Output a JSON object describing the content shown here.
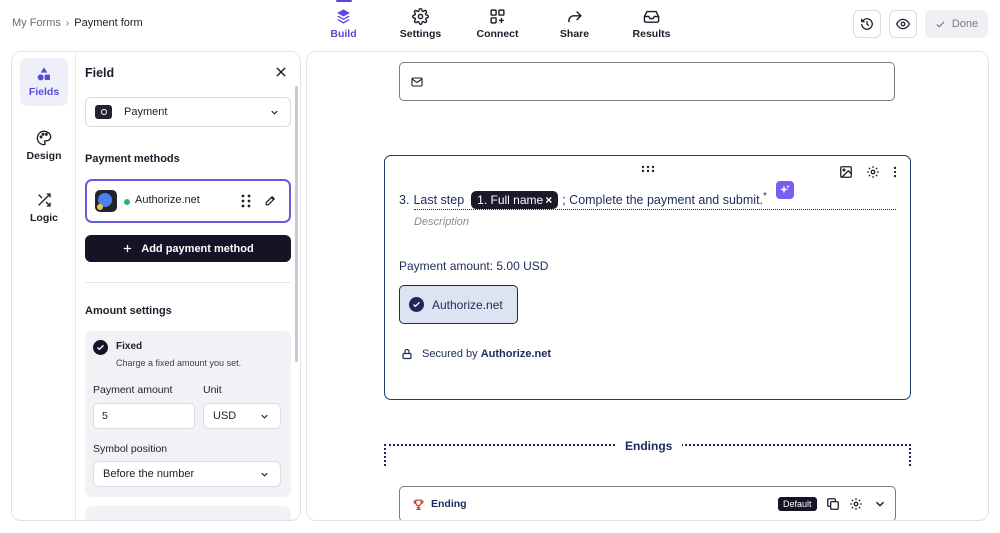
{
  "breadcrumb": {
    "root": "My Forms",
    "separator": "›",
    "current": "Payment form"
  },
  "nav": [
    {
      "label": "Build",
      "icon": "layers-icon",
      "active": true
    },
    {
      "label": "Settings",
      "icon": "gear-icon",
      "active": false
    },
    {
      "label": "Connect",
      "icon": "connect-icon",
      "active": false
    },
    {
      "label": "Share",
      "icon": "share-icon",
      "active": false
    },
    {
      "label": "Results",
      "icon": "inbox-icon",
      "active": false
    }
  ],
  "toolbar": {
    "history_icon": "history-icon",
    "preview_icon": "eye-icon",
    "done_label": "Done"
  },
  "rail": [
    {
      "label": "Fields",
      "icon": "shapes-icon",
      "active": true
    },
    {
      "label": "Design",
      "icon": "palette-icon",
      "active": false
    },
    {
      "label": "Logic",
      "icon": "shuffle-icon",
      "active": false
    }
  ],
  "panel": {
    "title": "Field",
    "field_type": "Payment",
    "methods_label": "Payment methods",
    "method_name": "Authorize.net",
    "add_method_label": "Add payment method",
    "amount_settings_label": "Amount settings",
    "fixed_title": "Fixed",
    "fixed_desc": "Charge a fixed amount you set.",
    "payment_amount_label": "Payment amount",
    "payment_amount_value": "5",
    "unit_label": "Unit",
    "unit_value": "USD",
    "symbol_position_label": "Symbol position",
    "symbol_position_value": "Before the number"
  },
  "canvas": {
    "question_number": "3.",
    "question_prefix": "Last step",
    "chip_label": "1. Full name",
    "chip_close": "×",
    "question_suffix": "; Complete the payment and submit.",
    "required_mark": "*",
    "description_placeholder": "Description",
    "payment_amount_text": "Payment amount: 5.00 USD",
    "provider_choice": "Authorize.net",
    "secured_prefix": "Secured by",
    "secured_provider": "Authorize.net",
    "endings_label": "Endings",
    "ending_title": "Ending",
    "ending_badge": "Default"
  },
  "colors": {
    "accent": "#5b4ad6",
    "navy": "#1b2a5a",
    "dark": "#141426",
    "ai": "#7d5cf0"
  }
}
